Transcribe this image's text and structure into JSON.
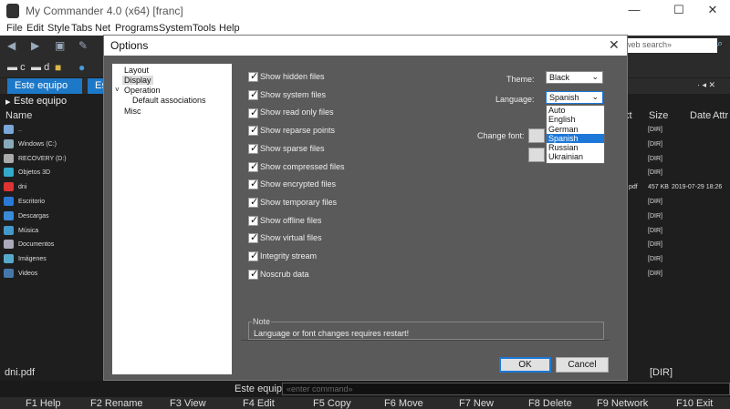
{
  "window": {
    "title": "My Commander 4.0 (x64) [franc]"
  },
  "menu": [
    "File",
    "Edit",
    "Style",
    "Tabs",
    "Net",
    "Programs",
    "System",
    "Tools",
    "Help"
  ],
  "toolbar": {
    "search_placeholder": "«web search»"
  },
  "drives": [
    "c",
    "d"
  ],
  "tabs": [
    "Este equipo",
    "Es"
  ],
  "left_panel": {
    "path": "Este equipo",
    "column_name": "Name",
    "items": [
      {
        "name": "..",
        "color": "#7aa7d8"
      },
      {
        "name": "Windows (C:)",
        "color": "#8ab"
      },
      {
        "name": "RECOVERY (D:)",
        "color": "#aaa"
      },
      {
        "name": "Objetos 3D",
        "color": "#3ac"
      },
      {
        "name": "dni",
        "color": "#d33"
      },
      {
        "name": "Escritorio",
        "color": "#2a7ad8"
      },
      {
        "name": "Descargas",
        "color": "#3a8ad8"
      },
      {
        "name": "Música",
        "color": "#49c"
      },
      {
        "name": "Documentos",
        "color": "#aab"
      },
      {
        "name": "Imágenes",
        "color": "#5ac"
      },
      {
        "name": "Videos",
        "color": "#47a"
      }
    ],
    "status": "dni.pdf"
  },
  "right_panel": {
    "columns": [
      "xt",
      "Size",
      "Date",
      "Attr"
    ],
    "rows": [
      {
        "ext": "",
        "size": "[DIR]",
        "date": ""
      },
      {
        "ext": "",
        "size": "[DIR]",
        "date": ""
      },
      {
        "ext": "",
        "size": "[DIR]",
        "date": ""
      },
      {
        "ext": "",
        "size": "[DIR]",
        "date": ""
      },
      {
        "ext": "pdf",
        "size": "457 KB",
        "date": "2019-07-29 18:26"
      },
      {
        "ext": "",
        "size": "[DIR]",
        "date": ""
      },
      {
        "ext": "",
        "size": "[DIR]",
        "date": ""
      },
      {
        "ext": "",
        "size": "[DIR]",
        "date": ""
      },
      {
        "ext": "",
        "size": "[DIR]",
        "date": ""
      },
      {
        "ext": "",
        "size": "[DIR]",
        "date": ""
      },
      {
        "ext": "",
        "size": "[DIR]",
        "date": ""
      }
    ],
    "status": "[DIR]"
  },
  "command": {
    "label": "Este equipo",
    "placeholder": "«enter command»"
  },
  "fkeys": [
    "F1 Help",
    "F2 Rename",
    "F3 View",
    "F4 Edit",
    "F5 Copy",
    "F6 Move",
    "F7 New",
    "F8 Delete",
    "F9 Network",
    "F10 Exit"
  ],
  "dialog": {
    "title": "Options",
    "tree": [
      "Layout",
      "Display",
      "Operation",
      "Default associations",
      "Misc"
    ],
    "checkboxes": [
      "Show hidden files",
      "Show system files",
      "Show read only files",
      "Show reparse points",
      "Show sparse files",
      "Show compressed files",
      "Show encrypted files",
      "Show temporary files",
      "Show offline files",
      "Show virtual files",
      "Integrity stream",
      "Noscrub data"
    ],
    "theme_label": "Theme:",
    "theme_value": "Black",
    "language_label": "Language:",
    "language_value": "Spanish",
    "language_options": [
      "Auto",
      "English",
      "German",
      "Spanish",
      "Russian",
      "Ukrainian"
    ],
    "font_label": "Change font:",
    "note_title": "Note",
    "note_text": "Language or font changes requires restart!",
    "ok": "OK",
    "cancel": "Cancel"
  }
}
